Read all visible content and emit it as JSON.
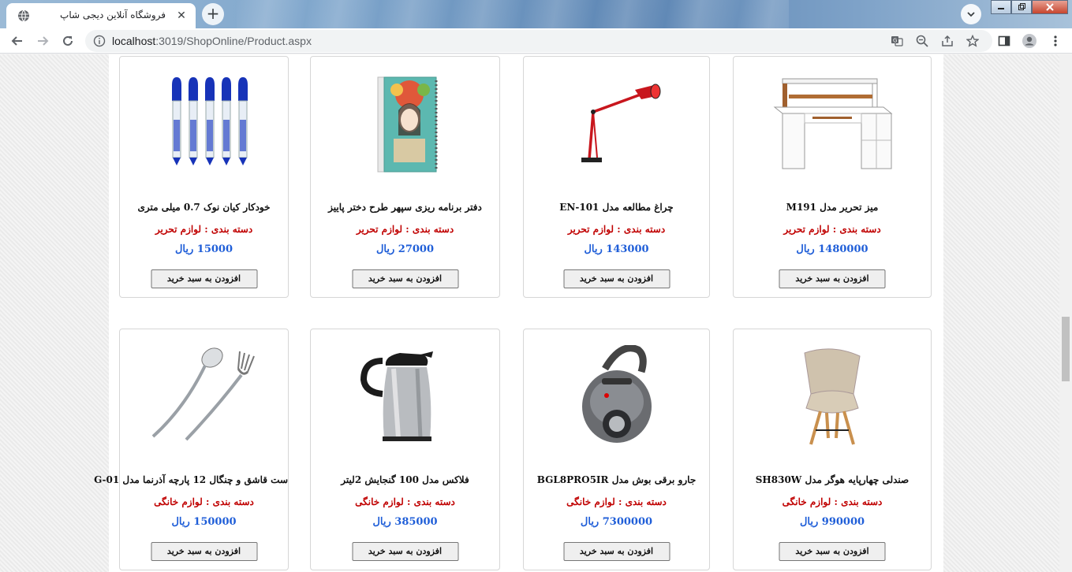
{
  "browser": {
    "tab_title": "فروشگاه آنلاین دیجی شاپ",
    "tab_close": "✕",
    "new_tab": "+",
    "url_host": "localhost",
    "url_path": ":3019/ShopOnline/Product.aspx"
  },
  "labels": {
    "category_prefix": "دسته بندی :",
    "currency": "ریال",
    "add_to_cart": "افزودن به سبد خرید"
  },
  "products": [
    {
      "name": "میز تحریر مدل M191",
      "category": "لوازم تحریر",
      "price": "1480000",
      "image": "desk-icon"
    },
    {
      "name": "چراغ مطالعه مدل EN-101",
      "category": "لوازم تحریر",
      "price": "143000",
      "image": "lamp-icon"
    },
    {
      "name": "دفتر برنامه ریزی سپهر طرح دختر پاییز",
      "category": "لوازم تحریر",
      "price": "27000",
      "image": "notebook-icon"
    },
    {
      "name": "خودکار کیان نوک 0.7 میلی متری",
      "category": "لوازم تحریر",
      "price": "15000",
      "image": "pens-icon"
    },
    {
      "name": "صندلی چهارپایه هوگر مدل SH830W",
      "category": "لوازم خانگی",
      "price": "990000",
      "image": "chair-icon"
    },
    {
      "name": "جارو برقی بوش مدل BGL8PRO5IR",
      "category": "لوازم خانگی",
      "price": "7300000",
      "image": "vacuum-icon"
    },
    {
      "name": "فلاکس مدل 100 گنجایش 2لیتر",
      "category": "لوازم خانگی",
      "price": "385000",
      "image": "flask-icon"
    },
    {
      "name": "ست قاشق و چنگال 12 پارچه آذرنما مدل G-01",
      "category": "لوازم خانگی",
      "price": "150000",
      "image": "cutlery-icon"
    }
  ]
}
